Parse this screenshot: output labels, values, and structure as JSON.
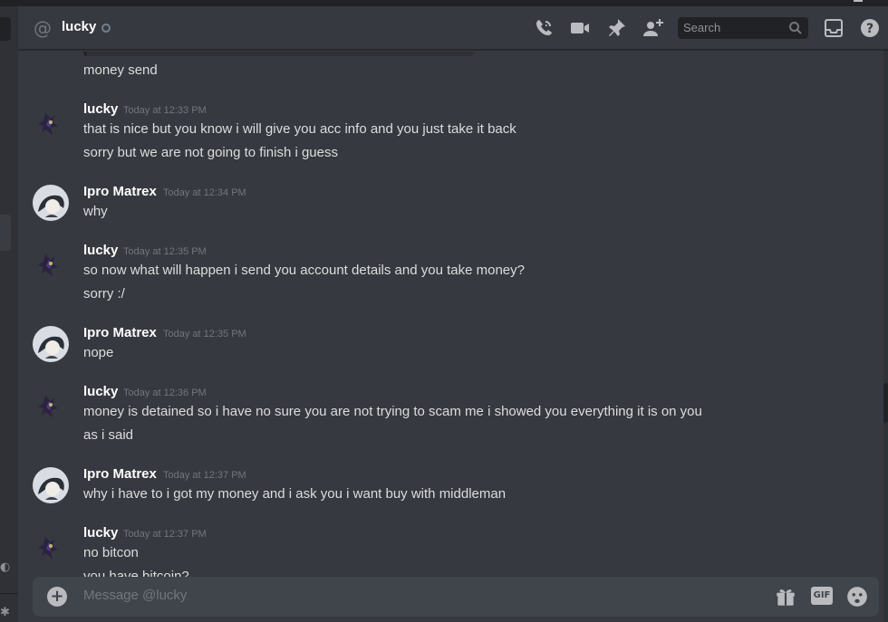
{
  "header": {
    "channel_name": "lucky",
    "search_placeholder": "Search",
    "icons": [
      "at-icon",
      "phone-call-icon",
      "video-icon",
      "pin-icon",
      "add-user-icon",
      "search-icon",
      "inbox-icon",
      "help-icon"
    ]
  },
  "messages": [
    {
      "type": "continuation",
      "lines": [
        "money send"
      ]
    },
    {
      "author": "lucky",
      "timestamp": "Today at 12:33 PM",
      "avatar": "lucky-avatar",
      "lines": [
        "that is nice but you know i will give you acc info and you just take it back",
        "sorry but we are not going to finish i guess"
      ]
    },
    {
      "author": "Ipro Matrex",
      "timestamp": "Today at 12:34 PM",
      "avatar": "ipro-avatar",
      "lines": [
        "why"
      ]
    },
    {
      "author": "lucky",
      "timestamp": "Today at 12:35 PM",
      "avatar": "lucky-avatar",
      "lines": [
        "so now what will happen i send you account details and you take money?",
        "sorry :/"
      ]
    },
    {
      "author": "Ipro Matrex",
      "timestamp": "Today at 12:35 PM",
      "avatar": "ipro-avatar",
      "lines": [
        "nope"
      ]
    },
    {
      "author": "lucky",
      "timestamp": "Today at 12:36 PM",
      "avatar": "lucky-avatar",
      "lines": [
        "money is detained so i have no sure you are not trying to scam me i showed you everything it is on you",
        "as i said"
      ]
    },
    {
      "author": "Ipro Matrex",
      "timestamp": "Today at 12:37 PM",
      "avatar": "ipro-avatar",
      "lines": [
        "why i have to i got my money and i ask you i want buy with middleman"
      ]
    },
    {
      "author": "lucky",
      "timestamp": "Today at 12:37 PM",
      "avatar": "lucky-avatar",
      "lines": [
        "no bitcon",
        "you have bitcoin?"
      ]
    }
  ],
  "composer": {
    "placeholder": "Message @lucky",
    "gif_label": "GIF",
    "icons": [
      "add-attachment-icon",
      "gift-icon",
      "gif-icon",
      "emoji-icon"
    ]
  },
  "colors": {
    "background": "#36393f",
    "sidebar": "#2f3136",
    "dark": "#202225",
    "text": "#dcddde",
    "muted": "#72767d",
    "username": "#ffffff"
  }
}
